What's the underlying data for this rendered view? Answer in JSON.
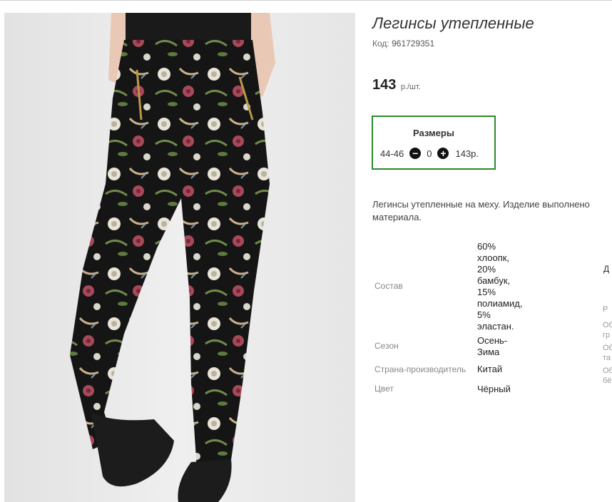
{
  "product": {
    "title": "Легинсы утепленные",
    "code_label": "Код:",
    "code": "961729351",
    "price": "143",
    "price_unit": "р./шт."
  },
  "sizes": {
    "header": "Размеры",
    "size": "44-46",
    "quantity": "0",
    "price": "143р."
  },
  "description": {
    "line1": "Легинсы утепленные на меху. Изделие выполнено",
    "line2": "материала."
  },
  "specs": [
    {
      "label": "Состав",
      "value_lines": [
        "60%",
        "хлоопк,",
        "20%",
        "бамбук,",
        "15%",
        "полиамид,",
        "5%",
        "эластан."
      ]
    },
    {
      "label": "Сезон",
      "value_lines": [
        "Осень-",
        "Зима"
      ]
    },
    {
      "label": "Страна-производитель",
      "value_lines": [
        "Китай"
      ]
    },
    {
      "label": "Цвет",
      "value_lines": [
        "Чёрный"
      ]
    }
  ],
  "cutoff": {
    "a": "Д",
    "b": "Р",
    "c": "Об",
    "d": "гр",
    "e": "Об",
    "f": "та",
    "g": "Об",
    "h": "бё"
  },
  "colors": {
    "accent_border": "#2b8a2b"
  },
  "icons": {
    "minus": "minus-circle-icon",
    "plus": "plus-circle-icon"
  }
}
